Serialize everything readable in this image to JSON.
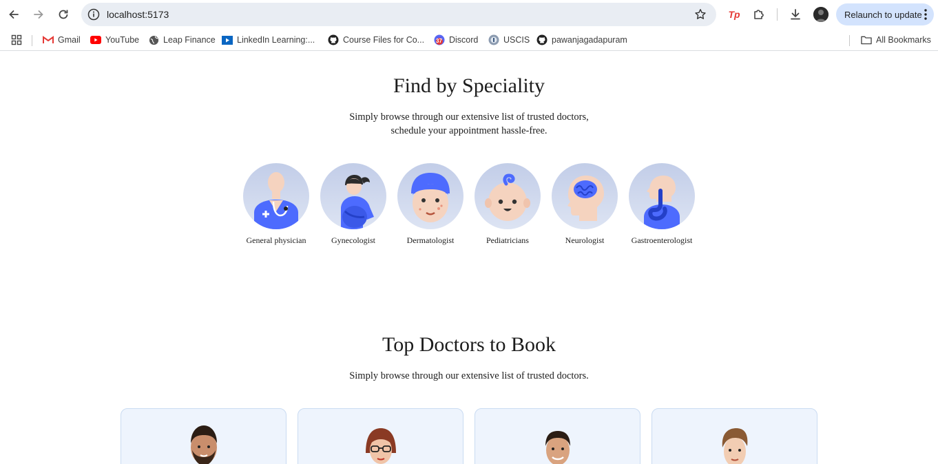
{
  "browser": {
    "url": "localhost:5173",
    "relaunch_label": "Relaunch to update",
    "bookmarks": [
      {
        "label": "Gmail",
        "icon": "gmail-icon"
      },
      {
        "label": "YouTube",
        "icon": "youtube-icon"
      },
      {
        "label": "Leap Finance",
        "icon": "globe-icon"
      },
      {
        "label": "LinkedIn Learning:...",
        "icon": "linkedin-learning-icon"
      },
      {
        "label": "Course Files for Co...",
        "icon": "github-icon"
      },
      {
        "label": "Discord",
        "icon": "discord-icon"
      },
      {
        "label": "USCIS",
        "icon": "uscis-icon"
      },
      {
        "label": "pawanjagadapuram",
        "icon": "github-icon"
      }
    ],
    "all_bookmarks_label": "All Bookmarks",
    "discord_badge": "37",
    "extension_label": "Tp"
  },
  "speciality": {
    "title": "Find by Speciality",
    "subtitle_line1": "Simply browse through our extensive list of trusted doctors,",
    "subtitle_line2": "schedule your appointment hassle-free.",
    "items": [
      {
        "label": "General physician"
      },
      {
        "label": "Gynecologist"
      },
      {
        "label": "Dermatologist"
      },
      {
        "label": "Pediatricians"
      },
      {
        "label": "Neurologist"
      },
      {
        "label": "Gastroenterologist"
      }
    ]
  },
  "top_doctors": {
    "title": "Top Doctors to Book",
    "subtitle": "Simply browse through our extensive list of trusted doctors."
  },
  "colors": {
    "accent": "#5f6fff",
    "card_bg": "#eef4fd",
    "relaunch_bg": "#d3e3fd"
  }
}
